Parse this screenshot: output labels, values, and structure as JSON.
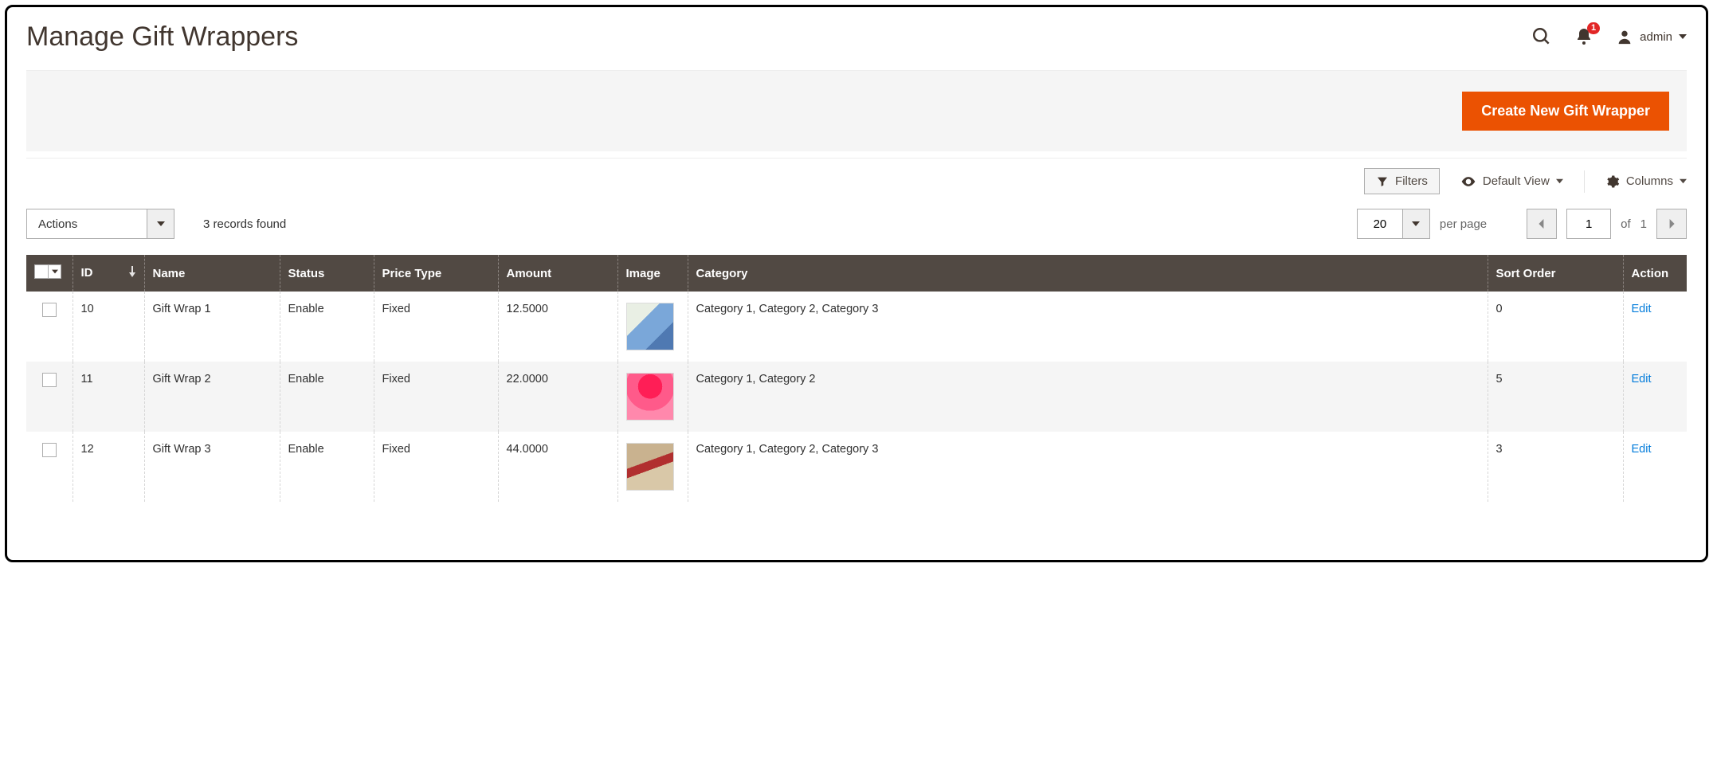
{
  "header": {
    "title": "Manage Gift Wrappers",
    "notification_count": "1",
    "user_label": "admin"
  },
  "actions": {
    "create_button": "Create New Gift Wrapper"
  },
  "toolbar": {
    "filters": "Filters",
    "default_view": "Default View",
    "columns": "Columns"
  },
  "grid": {
    "actions_label": "Actions",
    "records_found": "3 records found",
    "per_page_value": "20",
    "per_page_label": "per page",
    "current_page": "1",
    "of_label": "of",
    "total_pages": "1",
    "columns": {
      "id": "ID",
      "name": "Name",
      "status": "Status",
      "price_type": "Price Type",
      "amount": "Amount",
      "image": "Image",
      "category": "Category",
      "sort_order": "Sort Order",
      "action": "Action"
    },
    "rows": [
      {
        "id": "10",
        "name": "Gift Wrap 1",
        "status": "Enable",
        "price_type": "Fixed",
        "amount": "12.5000",
        "category": "Category 1, Category 2, Category 3",
        "sort_order": "0",
        "action": "Edit",
        "thumb_style": "background: linear-gradient(135deg,#e9efe4 0 35%,#7aa7d9 35% 70%,#4f79b2 70% 100%);"
      },
      {
        "id": "11",
        "name": "Gift Wrap 2",
        "status": "Enable",
        "price_type": "Fixed",
        "amount": "22.0000",
        "category": "Category 1, Category 2",
        "sort_order": "5",
        "action": "Edit",
        "thumb_style": "background: radial-gradient(circle at 50% 28%, #ff1e56 0 30%, #ff5a8a 30% 60%, #ff88ac 60% 100%);"
      },
      {
        "id": "12",
        "name": "Gift Wrap 3",
        "status": "Enable",
        "price_type": "Fixed",
        "amount": "44.0000",
        "category": "Category 1, Category 2, Category 3",
        "sort_order": "3",
        "action": "Edit",
        "thumb_style": "background: linear-gradient(160deg,#c9b28f 0 40%,#b12f2f 40% 55%,#d9c8a8 55% 100%);"
      }
    ]
  }
}
